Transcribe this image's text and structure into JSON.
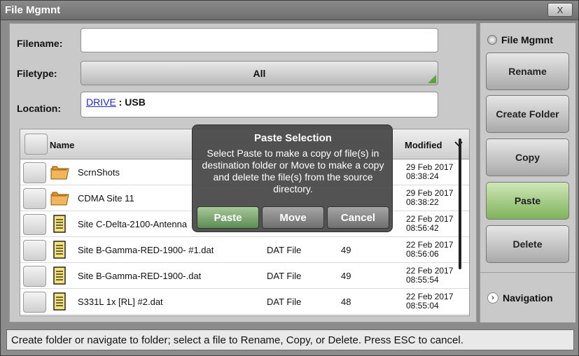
{
  "window": {
    "title": "File Mgmnt",
    "close_label": "X"
  },
  "form": {
    "filename_label": "Filename:",
    "filename_value": "",
    "filetype_label": "Filetype:",
    "filetype_value": "All",
    "location_label": "Location:",
    "location_drive": "DRIVE",
    "location_sep": " : ",
    "location_value": "USB"
  },
  "table": {
    "headers": {
      "name": "Name",
      "modified": "Modified"
    },
    "rows": [
      {
        "name": "ScrnShots",
        "type": "",
        "size": "",
        "modified_date": "29 Feb 2017",
        "modified_time": "08:38:24",
        "icon": "folder-icon"
      },
      {
        "name": "CDMA Site 11",
        "type": "",
        "size": "",
        "modified_date": "29 Feb 2017",
        "modified_time": "08:38:22",
        "icon": "folder-icon"
      },
      {
        "name": "Site C-Delta-2100-Antenna",
        "type": "",
        "size": "",
        "modified_date": "22 Feb 2017",
        "modified_time": "08:56:42",
        "icon": "document-icon"
      },
      {
        "name": "Site B-Gamma-RED-1900- #1.dat",
        "type": "DAT File",
        "size": "49",
        "modified_date": "22 Feb 2017",
        "modified_time": "08:56:06",
        "icon": "document-icon"
      },
      {
        "name": "Site B-Gamma-RED-1900-.dat",
        "type": "DAT File",
        "size": "49",
        "modified_date": "22 Feb 2017",
        "modified_time": "08:55:54",
        "icon": "document-icon"
      },
      {
        "name": "S331L 1x [RL] #2.dat",
        "type": "DAT File",
        "size": "48",
        "modified_date": "22 Feb 2017",
        "modified_time": "08:55:04",
        "icon": "document-icon"
      }
    ]
  },
  "popup": {
    "title": "Paste Selection",
    "body": "Select Paste to make a copy of file(s) in destination folder or Move to make a copy and delete the file(s) from the source directory.",
    "paste_label": "Paste",
    "move_label": "Move",
    "cancel_label": "Cancel"
  },
  "sidebar": {
    "header": "File Mgmnt",
    "rename": "Rename",
    "create_folder": "Create Folder",
    "copy": "Copy",
    "paste": "Paste",
    "delete": "Delete",
    "navigation": "Navigation"
  },
  "status": {
    "text": "Create folder or navigate to folder; select a file to Rename, Copy, or Delete. Press ESC to cancel."
  },
  "colors": {
    "accent_green": "#7fb35a",
    "link_blue": "#1a2ad8",
    "popup_bg": "#464646"
  }
}
